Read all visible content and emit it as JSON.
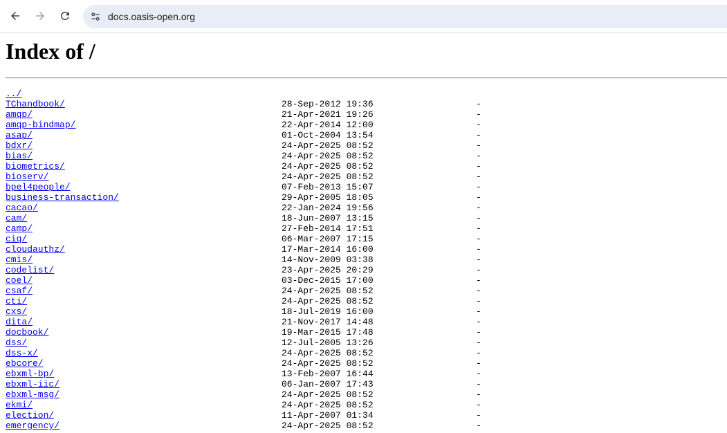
{
  "browser": {
    "url": "docs.oasis-open.org",
    "icons": {
      "back": "arrow-left-icon",
      "forward": "arrow-right-icon",
      "reload": "reload-icon",
      "site_info": "tune-icon"
    }
  },
  "page": {
    "title": "Index of /",
    "parent": "../",
    "entries": [
      {
        "name": "TChandbook/",
        "date": "28-Sep-2012 19:36",
        "size": "-"
      },
      {
        "name": "amqp/",
        "date": "21-Apr-2021 19:26",
        "size": "-"
      },
      {
        "name": "amqp-bindmap/",
        "date": "22-Apr-2014 12:00",
        "size": "-"
      },
      {
        "name": "asap/",
        "date": "01-Oct-2004 13:54",
        "size": "-"
      },
      {
        "name": "bdxr/",
        "date": "24-Apr-2025 08:52",
        "size": "-"
      },
      {
        "name": "bias/",
        "date": "24-Apr-2025 08:52",
        "size": "-"
      },
      {
        "name": "biometrics/",
        "date": "24-Apr-2025 08:52",
        "size": "-"
      },
      {
        "name": "bioserv/",
        "date": "24-Apr-2025 08:52",
        "size": "-"
      },
      {
        "name": "bpel4people/",
        "date": "07-Feb-2013 15:07",
        "size": "-"
      },
      {
        "name": "business-transaction/",
        "date": "29-Apr-2005 18:05",
        "size": "-"
      },
      {
        "name": "cacao/",
        "date": "22-Jan-2024 19:56",
        "size": "-"
      },
      {
        "name": "cam/",
        "date": "18-Jun-2007 13:15",
        "size": "-"
      },
      {
        "name": "camp/",
        "date": "27-Feb-2014 17:51",
        "size": "-"
      },
      {
        "name": "ciq/",
        "date": "06-Mar-2007 17:15",
        "size": "-"
      },
      {
        "name": "cloudauthz/",
        "date": "17-Mar-2014 16:00",
        "size": "-"
      },
      {
        "name": "cmis/",
        "date": "14-Nov-2009 03:38",
        "size": "-"
      },
      {
        "name": "codelist/",
        "date": "23-Apr-2025 20:29",
        "size": "-"
      },
      {
        "name": "coel/",
        "date": "03-Dec-2015 17:00",
        "size": "-"
      },
      {
        "name": "csaf/",
        "date": "24-Apr-2025 08:52",
        "size": "-"
      },
      {
        "name": "cti/",
        "date": "24-Apr-2025 08:52",
        "size": "-"
      },
      {
        "name": "cxs/",
        "date": "18-Jul-2019 16:00",
        "size": "-"
      },
      {
        "name": "dita/",
        "date": "21-Nov-2017 14:48",
        "size": "-"
      },
      {
        "name": "docbook/",
        "date": "19-Mar-2015 17:48",
        "size": "-"
      },
      {
        "name": "dss/",
        "date": "12-Jul-2005 13:26",
        "size": "-"
      },
      {
        "name": "dss-x/",
        "date": "24-Apr-2025 08:52",
        "size": "-"
      },
      {
        "name": "ebcore/",
        "date": "24-Apr-2025 08:52",
        "size": "-"
      },
      {
        "name": "ebxml-bp/",
        "date": "13-Feb-2007 16:44",
        "size": "-"
      },
      {
        "name": "ebxml-iic/",
        "date": "06-Jan-2007 17:43",
        "size": "-"
      },
      {
        "name": "ebxml-msg/",
        "date": "24-Apr-2025 08:52",
        "size": "-"
      },
      {
        "name": "ekmi/",
        "date": "24-Apr-2025 08:52",
        "size": "-"
      },
      {
        "name": "election/",
        "date": "11-Apr-2007 01:34",
        "size": "-"
      },
      {
        "name": "emergency/",
        "date": "24-Apr-2025 08:52",
        "size": "-"
      }
    ]
  }
}
